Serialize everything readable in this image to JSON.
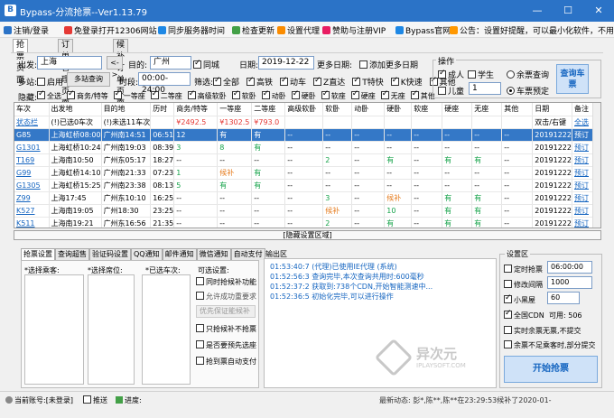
{
  "window": {
    "title": "Bypass-分流抢票--Ver1.13.79",
    "min": "—",
    "max": "☐",
    "close": "✕"
  },
  "menu": [
    {
      "label": "注销/登录",
      "color": "#2b73c7"
    },
    {
      "label": "免登录打开12306网站",
      "color": "#e53935"
    },
    {
      "label": "同步服务器时间",
      "color": "#1e88e5"
    },
    {
      "label": "检查更新",
      "color": "#43a047"
    },
    {
      "label": "设置代理",
      "color": "#fb8c00"
    },
    {
      "label": "赞助与注册VIP",
      "color": "#e91e63"
    },
    {
      "label": "Bypass官网",
      "color": "#1e88e5"
    },
    {
      "label": "公告：设置好提醒，可以最小化软件，不用盯着！",
      "color": "#ff9800"
    }
  ],
  "tabs": [
    "抢票页面",
    "订单管理页面",
    "候补订单页面"
  ],
  "query": {
    "from_label": "出发:",
    "from": "上海",
    "to_label": "目的:",
    "to": "广州",
    "swap": "<->",
    "same_city": "同城",
    "date_label": "日期:",
    "date": "2019-12-22",
    "more_dates": "更多日期:",
    "add_more_dates": "添加更多日期",
    "multi_label": "多站:",
    "enable": "启用",
    "multi_query": "多站查询",
    "period_label": "时段:",
    "period": "00:00-24:00",
    "filter_label": "筛选:",
    "filters": [
      "全部",
      "高铁",
      "动车",
      "Z直达",
      "T特快",
      "K快速",
      "其他"
    ],
    "hide_label": "隐藏:",
    "hide_items": [
      "全选",
      "商务/特等",
      "一等座",
      "二等座",
      "高级软卧",
      "软卧",
      "动卧",
      "硬卧",
      "软座",
      "硬座",
      "无座",
      "其他"
    ]
  },
  "ops": {
    "title": "操作",
    "adult": "成人",
    "student": "学生",
    "child": "儿童",
    "quantity": "1",
    "remaining": "余票查询",
    "book": "车票预定",
    "query_btn": "查询车票"
  },
  "table": {
    "headers": [
      "车次",
      "出发地",
      "目的地",
      "历时",
      "商务/特等",
      "一等座",
      "二等座",
      "高级软卧",
      "软卧",
      "动卧",
      "硬卧",
      "软座",
      "硬座",
      "无座",
      "其他",
      "日期",
      "备注"
    ],
    "status_row": [
      "状态栏",
      "(!)已选0车次",
      "(!)未选11车次",
      "",
      "¥2492.5",
      "¥1302.5",
      "¥793.0",
      "",
      "",
      "",
      "",
      "",
      "",
      "",
      "",
      "双击/右键",
      "全选"
    ],
    "rows": [
      [
        "G85",
        "上海虹桥08:00",
        "广州南14:51",
        "06:51",
        "12",
        "有",
        "有",
        "--",
        "--",
        "--",
        "--",
        "--",
        "--",
        "--",
        "--",
        "20191222",
        "预订"
      ],
      [
        "G1301",
        "上海虹桥10:24",
        "广州南19:03",
        "08:39",
        "3",
        "8",
        "有",
        "--",
        "--",
        "--",
        "--",
        "--",
        "--",
        "--",
        "--",
        "20191222",
        "预订"
      ],
      [
        "T169",
        "上海南10:50",
        "广州东05:17",
        "18:27",
        "--",
        "--",
        "--",
        "--",
        "2",
        "--",
        "有",
        "--",
        "有",
        "有",
        "--",
        "20191222",
        "预订"
      ],
      [
        "G99",
        "上海虹桥14:10",
        "广州南21:33",
        "07:23",
        "1",
        "候补",
        "有",
        "--",
        "--",
        "--",
        "--",
        "--",
        "--",
        "--",
        "--",
        "20191222",
        "预订"
      ],
      [
        "G1305",
        "上海虹桥15:25",
        "广州南23:38",
        "08:13",
        "5",
        "有",
        "有",
        "--",
        "--",
        "--",
        "--",
        "--",
        "--",
        "--",
        "--",
        "20191222",
        "预订"
      ],
      [
        "Z99",
        "上海17:45",
        "广州东10:10",
        "16:25",
        "--",
        "--",
        "--",
        "--",
        "3",
        "--",
        "候补",
        "--",
        "有",
        "有",
        "--",
        "20191222",
        "预订"
      ],
      [
        "K527",
        "上海南19:05",
        "广州18:30",
        "23:25",
        "--",
        "--",
        "--",
        "--",
        "候补",
        "--",
        "10",
        "--",
        "有",
        "有",
        "--",
        "20191222",
        "预订"
      ],
      [
        "K511",
        "上海南19:21",
        "广州东16:56",
        "21:35",
        "--",
        "--",
        "--",
        "--",
        "2",
        "--",
        "有",
        "--",
        "有",
        "有",
        "--",
        "20191222",
        "预订"
      ]
    ]
  },
  "hidden_area": "[隐藏设置区域]",
  "subtabs": [
    "抢票设置",
    "查询超售",
    "验证码设置",
    "QQ通知",
    "邮件通知",
    "微信通知",
    "自动支付"
  ],
  "settings": {
    "passengers_label": "*选择乘客:",
    "seats_label": "*选择席位:",
    "trains_label": "*已选车次:",
    "options_label": "可选设置:",
    "opts": [
      "同时抢候补功能",
      "允许成功重要求",
      "只抢候补不抢票",
      "是否要预先选座",
      "抢到票自动支付"
    ],
    "priority": "优先保证能候补"
  },
  "log": {
    "title": "输出区",
    "lines": [
      "01:53:40:7 (代理)已使用IE代理 (系统)",
      "01:52:56:3 查询完毕,本次查询共用时:600毫秒",
      "01:52:37:2 获取到:738个CDN,开始智能测速中...",
      "01:52:36:5 初始化完毕,可以进行操作"
    ]
  },
  "config": {
    "title": "设置区",
    "timer": "定时抢票",
    "timer_val": "06:00:00",
    "interval": "修改间隔",
    "interval_val": "1000",
    "xiaoheiwu": "小黑屋",
    "xiaoheiwu_val": "60",
    "cdn": "全国CDN",
    "available": "可用:",
    "available_val": "506",
    "no_submit": "实时余票无票,不提交",
    "partial": "余票不足乘客时,部分提交",
    "start_btn": "开始抢票"
  },
  "status": {
    "account": "当前账号:[未登录]",
    "push": "推送",
    "progress": "进度:",
    "dynamic": "最新动态: 彭*,陈**,陈**在23:29:53候补了2020-01-"
  },
  "watermark": {
    "cn": "异次元",
    "en": "IPLAYSOFT.COM"
  }
}
